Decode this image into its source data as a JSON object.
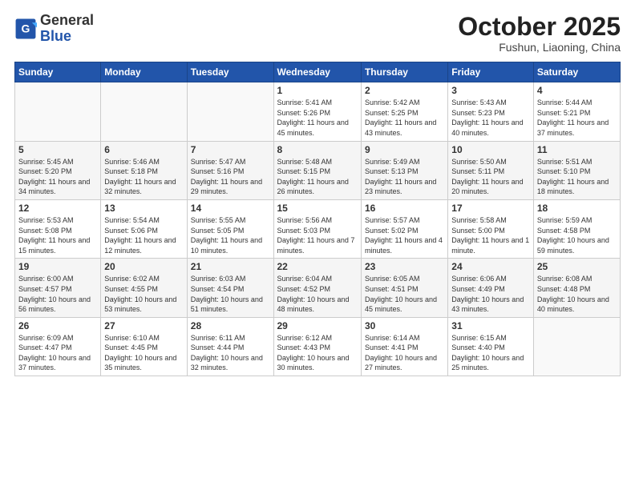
{
  "header": {
    "logo": {
      "general": "General",
      "blue": "Blue"
    },
    "month": "October 2025",
    "location": "Fushun, Liaoning, China"
  },
  "weekdays": [
    "Sunday",
    "Monday",
    "Tuesday",
    "Wednesday",
    "Thursday",
    "Friday",
    "Saturday"
  ],
  "weeks": [
    [
      {
        "day": "",
        "info": ""
      },
      {
        "day": "",
        "info": ""
      },
      {
        "day": "",
        "info": ""
      },
      {
        "day": "1",
        "info": "Sunrise: 5:41 AM\nSunset: 5:26 PM\nDaylight: 11 hours\nand 45 minutes."
      },
      {
        "day": "2",
        "info": "Sunrise: 5:42 AM\nSunset: 5:25 PM\nDaylight: 11 hours\nand 43 minutes."
      },
      {
        "day": "3",
        "info": "Sunrise: 5:43 AM\nSunset: 5:23 PM\nDaylight: 11 hours\nand 40 minutes."
      },
      {
        "day": "4",
        "info": "Sunrise: 5:44 AM\nSunset: 5:21 PM\nDaylight: 11 hours\nand 37 minutes."
      }
    ],
    [
      {
        "day": "5",
        "info": "Sunrise: 5:45 AM\nSunset: 5:20 PM\nDaylight: 11 hours\nand 34 minutes."
      },
      {
        "day": "6",
        "info": "Sunrise: 5:46 AM\nSunset: 5:18 PM\nDaylight: 11 hours\nand 32 minutes."
      },
      {
        "day": "7",
        "info": "Sunrise: 5:47 AM\nSunset: 5:16 PM\nDaylight: 11 hours\nand 29 minutes."
      },
      {
        "day": "8",
        "info": "Sunrise: 5:48 AM\nSunset: 5:15 PM\nDaylight: 11 hours\nand 26 minutes."
      },
      {
        "day": "9",
        "info": "Sunrise: 5:49 AM\nSunset: 5:13 PM\nDaylight: 11 hours\nand 23 minutes."
      },
      {
        "day": "10",
        "info": "Sunrise: 5:50 AM\nSunset: 5:11 PM\nDaylight: 11 hours\nand 20 minutes."
      },
      {
        "day": "11",
        "info": "Sunrise: 5:51 AM\nSunset: 5:10 PM\nDaylight: 11 hours\nand 18 minutes."
      }
    ],
    [
      {
        "day": "12",
        "info": "Sunrise: 5:53 AM\nSunset: 5:08 PM\nDaylight: 11 hours\nand 15 minutes."
      },
      {
        "day": "13",
        "info": "Sunrise: 5:54 AM\nSunset: 5:06 PM\nDaylight: 11 hours\nand 12 minutes."
      },
      {
        "day": "14",
        "info": "Sunrise: 5:55 AM\nSunset: 5:05 PM\nDaylight: 11 hours\nand 10 minutes."
      },
      {
        "day": "15",
        "info": "Sunrise: 5:56 AM\nSunset: 5:03 PM\nDaylight: 11 hours\nand 7 minutes."
      },
      {
        "day": "16",
        "info": "Sunrise: 5:57 AM\nSunset: 5:02 PM\nDaylight: 11 hours\nand 4 minutes."
      },
      {
        "day": "17",
        "info": "Sunrise: 5:58 AM\nSunset: 5:00 PM\nDaylight: 11 hours\nand 1 minute."
      },
      {
        "day": "18",
        "info": "Sunrise: 5:59 AM\nSunset: 4:58 PM\nDaylight: 10 hours\nand 59 minutes."
      }
    ],
    [
      {
        "day": "19",
        "info": "Sunrise: 6:00 AM\nSunset: 4:57 PM\nDaylight: 10 hours\nand 56 minutes."
      },
      {
        "day": "20",
        "info": "Sunrise: 6:02 AM\nSunset: 4:55 PM\nDaylight: 10 hours\nand 53 minutes."
      },
      {
        "day": "21",
        "info": "Sunrise: 6:03 AM\nSunset: 4:54 PM\nDaylight: 10 hours\nand 51 minutes."
      },
      {
        "day": "22",
        "info": "Sunrise: 6:04 AM\nSunset: 4:52 PM\nDaylight: 10 hours\nand 48 minutes."
      },
      {
        "day": "23",
        "info": "Sunrise: 6:05 AM\nSunset: 4:51 PM\nDaylight: 10 hours\nand 45 minutes."
      },
      {
        "day": "24",
        "info": "Sunrise: 6:06 AM\nSunset: 4:49 PM\nDaylight: 10 hours\nand 43 minutes."
      },
      {
        "day": "25",
        "info": "Sunrise: 6:08 AM\nSunset: 4:48 PM\nDaylight: 10 hours\nand 40 minutes."
      }
    ],
    [
      {
        "day": "26",
        "info": "Sunrise: 6:09 AM\nSunset: 4:47 PM\nDaylight: 10 hours\nand 37 minutes."
      },
      {
        "day": "27",
        "info": "Sunrise: 6:10 AM\nSunset: 4:45 PM\nDaylight: 10 hours\nand 35 minutes."
      },
      {
        "day": "28",
        "info": "Sunrise: 6:11 AM\nSunset: 4:44 PM\nDaylight: 10 hours\nand 32 minutes."
      },
      {
        "day": "29",
        "info": "Sunrise: 6:12 AM\nSunset: 4:43 PM\nDaylight: 10 hours\nand 30 minutes."
      },
      {
        "day": "30",
        "info": "Sunrise: 6:14 AM\nSunset: 4:41 PM\nDaylight: 10 hours\nand 27 minutes."
      },
      {
        "day": "31",
        "info": "Sunrise: 6:15 AM\nSunset: 4:40 PM\nDaylight: 10 hours\nand 25 minutes."
      },
      {
        "day": "",
        "info": ""
      }
    ]
  ]
}
